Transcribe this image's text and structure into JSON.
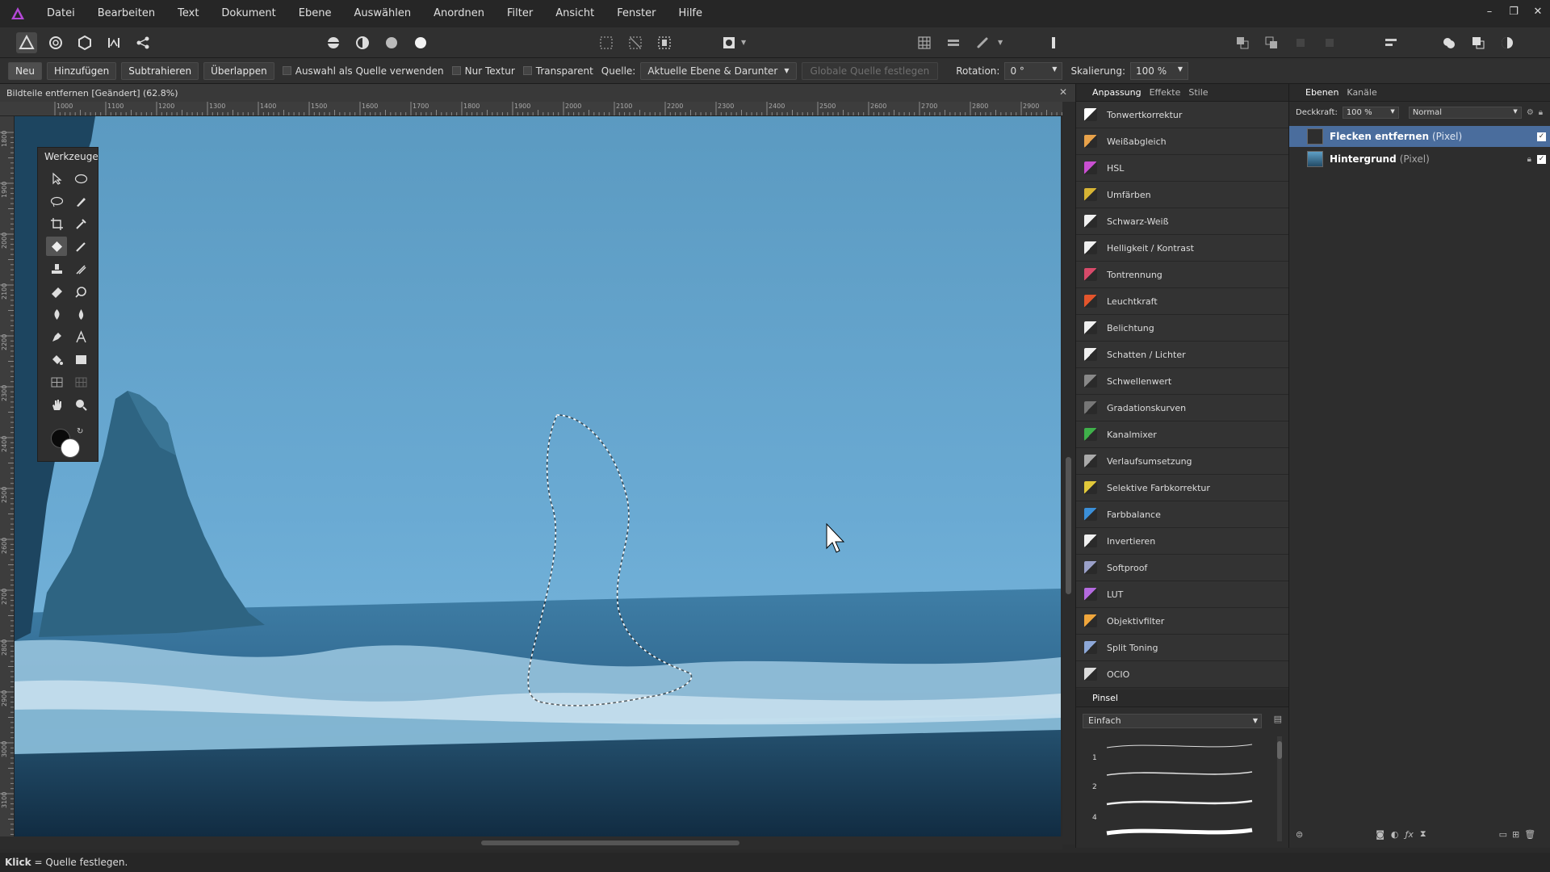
{
  "menu": {
    "items": [
      "Datei",
      "Bearbeiten",
      "Text",
      "Dokument",
      "Ebene",
      "Auswählen",
      "Anordnen",
      "Filter",
      "Ansicht",
      "Fenster",
      "Hilfe"
    ]
  },
  "context_bar": {
    "btn_new": "Neu",
    "btn_add": "Hinzufügen",
    "btn_subtract": "Subtrahieren",
    "btn_overlap": "Überlappen",
    "check_source": "Auswahl als Quelle verwenden",
    "check_texture": "Nur Textur",
    "check_transparent": "Transparent",
    "source_label": "Quelle:",
    "source_value": "Aktuelle Ebene & Darunter",
    "global_source": "Globale Quelle festlegen",
    "rotation_label": "Rotation:",
    "rotation_value": "0 °",
    "scale_label": "Skalierung:",
    "scale_value": "100 %"
  },
  "document": {
    "tab_title": "Bildteile entfernen [Geändert] (62.8%)"
  },
  "ruler": {
    "top_ticks": [
      "1000",
      "1100",
      "1200",
      "1300",
      "1400",
      "1500",
      "1600",
      "1700",
      "1800",
      "1900",
      "2000",
      "2100",
      "2200",
      "2300",
      "2400",
      "2500",
      "2600",
      "2700",
      "2800",
      "2900"
    ],
    "left_ticks": [
      "1800",
      "1900",
      "2000",
      "2100",
      "2200",
      "2300",
      "2400",
      "2500",
      "2600",
      "2700",
      "2800",
      "2900",
      "3000",
      "3100"
    ]
  },
  "tools": {
    "title": "Werkzeuge"
  },
  "adjustments": {
    "tabs": [
      "Anpassung",
      "Effekte",
      "Stile"
    ],
    "items": [
      {
        "label": "Tonwertkorrektur",
        "color": "#ffffff"
      },
      {
        "label": "Weißabgleich",
        "color": "#e8a24a"
      },
      {
        "label": "HSL",
        "color": "#c94fd1"
      },
      {
        "label": "Umfärben",
        "color": "#d7b434"
      },
      {
        "label": "Schwarz-Weiß",
        "color": "#f0f0f0"
      },
      {
        "label": "Helligkeit / Kontrast",
        "color": "#f0f0f0"
      },
      {
        "label": "Tontrennung",
        "color": "#d84a6a"
      },
      {
        "label": "Leuchtkraft",
        "color": "#e3552c"
      },
      {
        "label": "Belichtung",
        "color": "#f0f0f0"
      },
      {
        "label": "Schatten / Lichter",
        "color": "#f0f0f0"
      },
      {
        "label": "Schwellenwert",
        "color": "#888888"
      },
      {
        "label": "Gradationskurven",
        "color": "#777777"
      },
      {
        "label": "Kanalmixer",
        "color": "#3fb04a"
      },
      {
        "label": "Verlaufsumsetzung",
        "color": "#aaaaaa"
      },
      {
        "label": "Selektive Farbkorrektur",
        "color": "#e1c83a"
      },
      {
        "label": "Farbbalance",
        "color": "#3b8fd8"
      },
      {
        "label": "Invertieren",
        "color": "#f0f0f0"
      },
      {
        "label": "Softproof",
        "color": "#9aa0c8"
      },
      {
        "label": "LUT",
        "color": "#b46adf"
      },
      {
        "label": "Objektivfilter",
        "color": "#f0a63c"
      },
      {
        "label": "Split Toning",
        "color": "#8da8d8"
      },
      {
        "label": "OCIO",
        "color": "#dddddd"
      }
    ]
  },
  "brushes": {
    "title": "Pinsel",
    "category": "Einfach",
    "sizes": [
      "1",
      "2",
      "4"
    ]
  },
  "layers": {
    "tabs": [
      "Ebenen",
      "Kanäle"
    ],
    "opacity_label": "Deckkraft:",
    "opacity_value": "100 %",
    "blend_mode": "Normal",
    "items": [
      {
        "name": "Flecken entfernen",
        "type": "(Pixel)",
        "selected": true
      },
      {
        "name": "Hintergrund",
        "type": "(Pixel)",
        "selected": false
      }
    ]
  },
  "status": {
    "key": "Klick",
    "text": "= Quelle festlegen."
  },
  "colors": {
    "accent": "#4a6d9d",
    "sky_top": "#5e9fc6",
    "sky_bottom": "#7ab7dc"
  }
}
